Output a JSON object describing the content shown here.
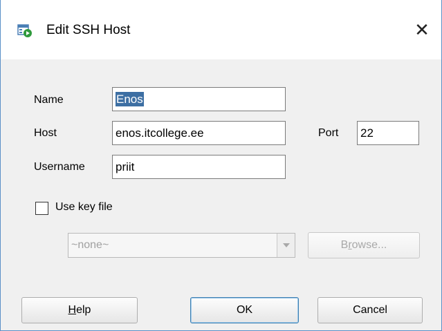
{
  "window": {
    "title": "Edit SSH Host",
    "close_glyph": "✕"
  },
  "form": {
    "name_label": "Name",
    "name_value": "Enos",
    "host_label": "Host",
    "host_value": "enos.itcollege.ee",
    "port_label": "Port",
    "port_value": "22",
    "username_label": "Username",
    "username_value": "priit",
    "use_key_label": "Use key file",
    "use_key_checked": false,
    "key_file_value": "~none~"
  },
  "buttons": {
    "browse_label": "Browse...",
    "browse_mnemonic": "r",
    "help_label": "Help",
    "help_mnemonic": "H",
    "ok_label": "OK",
    "cancel_label": "Cancel"
  },
  "colors": {
    "accent": "#3d6fa3",
    "icon_green": "#2f9a3c",
    "icon_blue": "#4a7fb5"
  },
  "icons": [
    "ssh-host-app-icon",
    "close-icon",
    "dropdown-arrow-icon",
    "checkbox"
  ]
}
